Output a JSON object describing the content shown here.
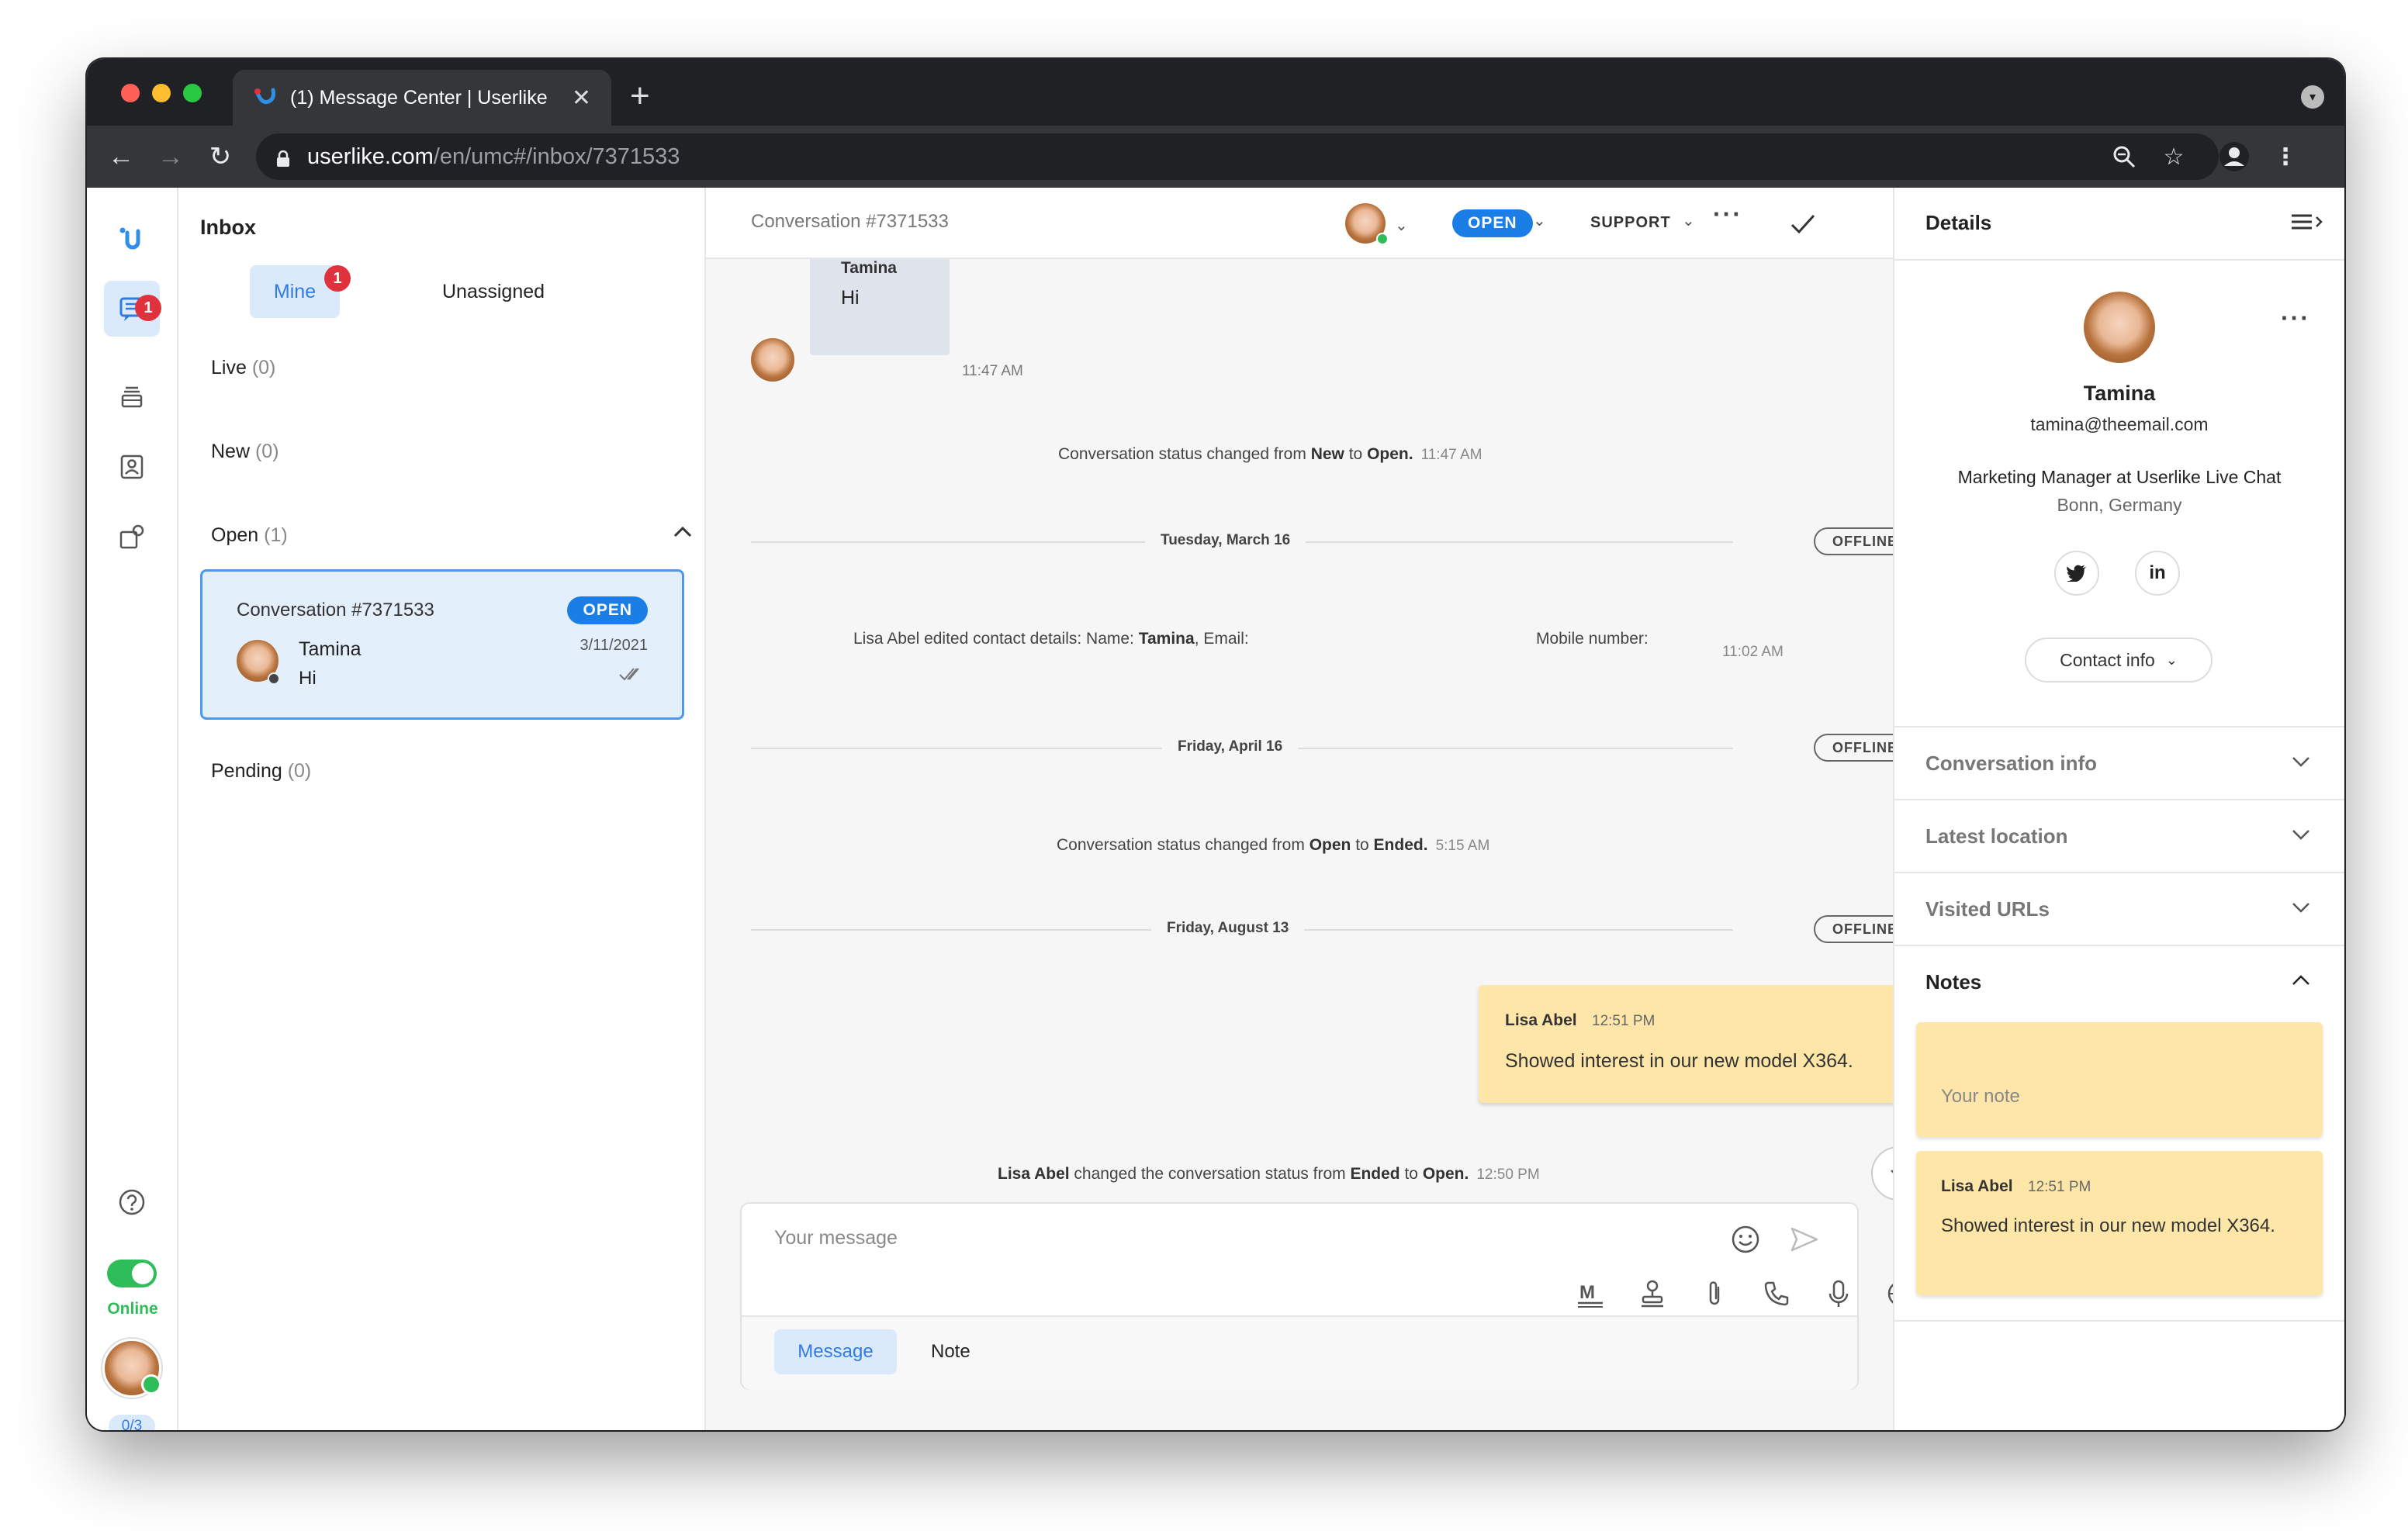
{
  "browser": {
    "tab_title": "(1) Message Center | Userlike",
    "tab_close": "✕",
    "new_tab": "+",
    "url_host": "userlike.com",
    "url_path": "/en/umc#/inbox/7371533"
  },
  "colors": {
    "accent": "#1a7ee6",
    "badge_red": "#e0323c",
    "online_green": "#2ebd59",
    "note_yellow": "#fde6a8"
  },
  "sidebar": {
    "logo": "U",
    "chat_badge": "1",
    "status_label": "Online",
    "capacity": "0/3",
    "icons": [
      "userlike-logo",
      "chat-icon",
      "stack-icon",
      "contacts-icon",
      "integrations-icon",
      "help-icon"
    ]
  },
  "inbox": {
    "title": "Inbox",
    "tab_mine": "Mine",
    "tab_mine_badge": "1",
    "tab_unassigned": "Unassigned",
    "sections": [
      {
        "label": "Live",
        "count": "(0)"
      },
      {
        "label": "New",
        "count": "(0)"
      },
      {
        "label": "Open",
        "count": "(1)"
      },
      {
        "label": "Pending",
        "count": "(0)"
      }
    ],
    "conversation": {
      "title": "Conversation #7371533",
      "status": "OPEN",
      "date": "3/11/2021",
      "name": "Tamina",
      "preview": "Hi"
    }
  },
  "chat_header": {
    "title": "Conversation #7371533",
    "status": "OPEN",
    "group": "SUPPORT"
  },
  "messages": {
    "first": {
      "name": "Tamina",
      "text": "Hi",
      "time": "11:47 AM"
    },
    "sys1": {
      "pre": "Conversation status changed from ",
      "from": "New",
      "mid": " to ",
      "to": "Open.",
      "time": "11:47 AM"
    },
    "date1": "Tuesday, March 16",
    "offline": "OFFLINE",
    "edit": {
      "text": "Lisa Abel edited contact details: Name: ",
      "name": "Tamina",
      "email": ", Email:",
      "mobile": "Mobile number:",
      "time": "11:02 AM"
    },
    "date2": "Friday, April 16",
    "sys2": {
      "pre": "Conversation status changed from ",
      "from": "Open",
      "mid": " to ",
      "to": "Ended.",
      "time": "5:15 AM"
    },
    "date3": "Friday, August 13",
    "note": {
      "author": "Lisa Abel",
      "time": "12:51 PM",
      "text": "Showed interest in our new model X364."
    },
    "sys3": {
      "actor": "Lisa Abel",
      "pre": " changed the conversation status from ",
      "from": "Ended",
      "mid": " to ",
      "to": "Open.",
      "time": "12:50 PM"
    }
  },
  "composer": {
    "placeholder": "Your message",
    "tab_message": "Message",
    "tab_note": "Note",
    "icons": [
      "markdown-icon",
      "stamp-icon",
      "paperclip-icon",
      "phone-icon",
      "microphone-icon",
      "globe-icon"
    ]
  },
  "details": {
    "title": "Details",
    "name": "Tamina",
    "email": "tamina@theemail.com",
    "job": "Marketing Manager at Userlike Live Chat",
    "location": "Bonn, Germany",
    "twitter": "twitter-icon",
    "linkedin": "in",
    "contact_info_button": "Contact info",
    "sections": [
      "Conversation info",
      "Latest location",
      "Visited URLs"
    ],
    "notes_title": "Notes",
    "note_placeholder": "Your note",
    "note": {
      "author": "Lisa Abel",
      "time": "12:51 PM",
      "text": "Showed interest in our new model X364."
    }
  }
}
